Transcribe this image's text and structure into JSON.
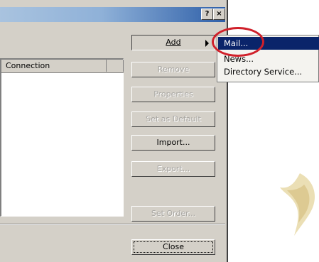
{
  "title_buttons": {
    "help": "?",
    "close": "×"
  },
  "list": {
    "columns": [
      "Connection",
      ""
    ]
  },
  "buttons": {
    "add": "Add",
    "remove": "Remove",
    "properties": "Properties",
    "set_default": "Set as Default",
    "import": "Import...",
    "export": "Export...",
    "set_order": "Set Order...",
    "close": "Close"
  },
  "submenu": {
    "items": [
      "Mail...",
      "News...",
      "Directory Service..."
    ],
    "selected_index": 0
  },
  "colors": {
    "selection": "#0a246a",
    "highlight_ring": "#d0202a",
    "dialog_face": "#d4d0c8"
  }
}
